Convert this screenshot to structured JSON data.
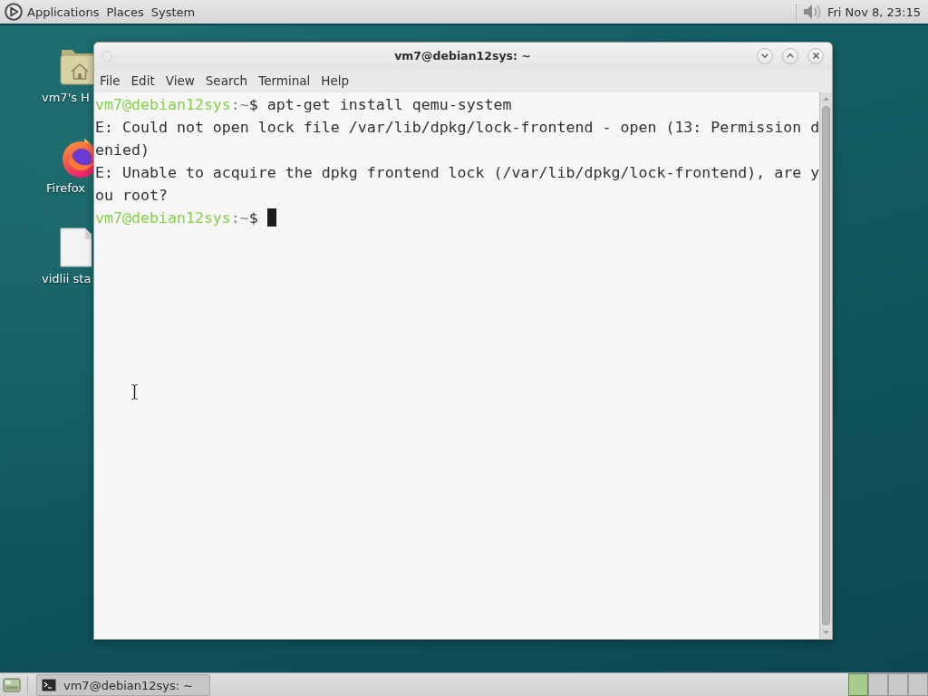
{
  "top_panel": {
    "menus": [
      "Applications",
      "Places",
      "System"
    ],
    "clock": "Fri Nov 8, 23:15"
  },
  "desktop_icons": [
    {
      "kind": "home-folder",
      "label": "vm7's H"
    },
    {
      "kind": "browser",
      "label": "Firefox"
    },
    {
      "kind": "document",
      "label": "vidlii sta"
    }
  ],
  "window": {
    "title": "vm7@debian12sys: ~",
    "menu": [
      "File",
      "Edit",
      "View",
      "Search",
      "Terminal",
      "Help"
    ],
    "terminal": {
      "lines": [
        {
          "kind": "prompt",
          "user_host": "vm7@debian12sys",
          "separator": ":",
          "path": "~",
          "symbol": "$",
          "command": "apt-get install qemu-system",
          "cursor": false
        },
        {
          "kind": "output",
          "text": "E: Could not open lock file /var/lib/dpkg/lock-frontend - open (13: Permission denied)",
          "cursor": false
        },
        {
          "kind": "output",
          "text": "E: Unable to acquire the dpkg frontend lock (/var/lib/dpkg/lock-frontend), are you root?",
          "cursor": false
        },
        {
          "kind": "prompt",
          "user_host": "vm7@debian12sys",
          "separator": ":",
          "path": "~",
          "symbol": "$",
          "cursor": true
        }
      ]
    }
  },
  "taskbar": {
    "tasks": [
      {
        "label": "vm7@debian12sys: ~",
        "selected": true
      }
    ],
    "workspaces": [
      {
        "selected": true
      },
      {
        "selected": false
      },
      {
        "selected": false
      },
      {
        "selected": false
      }
    ]
  }
}
